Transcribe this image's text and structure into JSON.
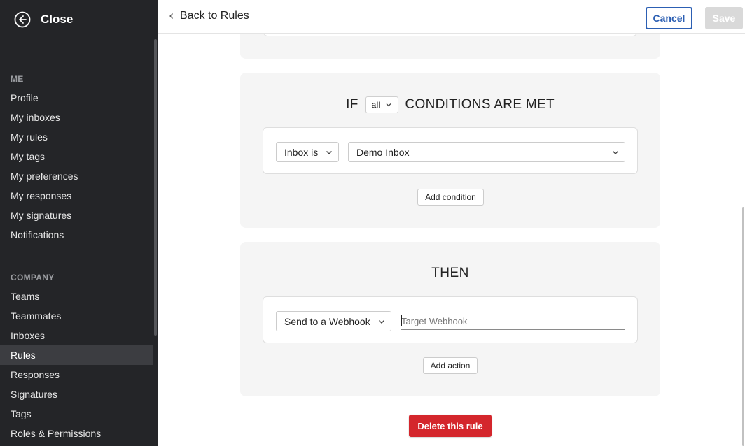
{
  "sidebar": {
    "close_label": "Close",
    "me_heading": "ME",
    "me_items": [
      {
        "label": "Profile"
      },
      {
        "label": "My inboxes"
      },
      {
        "label": "My rules"
      },
      {
        "label": "My tags"
      },
      {
        "label": "My preferences"
      },
      {
        "label": "My responses"
      },
      {
        "label": "My signatures"
      },
      {
        "label": "Notifications"
      }
    ],
    "company_heading": "COMPANY",
    "company_items": [
      {
        "label": "Teams"
      },
      {
        "label": "Teammates"
      },
      {
        "label": "Inboxes"
      },
      {
        "label": "Rules",
        "active": true
      },
      {
        "label": "Responses"
      },
      {
        "label": "Signatures"
      },
      {
        "label": "Tags"
      },
      {
        "label": "Roles & Permissions"
      }
    ]
  },
  "header": {
    "back_label": "Back to Rules",
    "cancel_label": "Cancel",
    "save_label": "Save"
  },
  "conditions": {
    "prefix": "IF",
    "match_value": "all",
    "suffix": "CONDITIONS ARE MET",
    "condition_operator": "Inbox is",
    "condition_value": "Demo Inbox",
    "add_condition_label": "Add condition"
  },
  "actions": {
    "heading": "THEN",
    "action_type": "Send to a Webhook",
    "webhook_placeholder": "Target Webhook",
    "webhook_value": "",
    "add_action_label": "Add action"
  },
  "delete_label": "Delete this rule",
  "colors": {
    "sidebar_bg": "#242528",
    "accent": "#2c5fb3",
    "danger": "#d4262c"
  }
}
